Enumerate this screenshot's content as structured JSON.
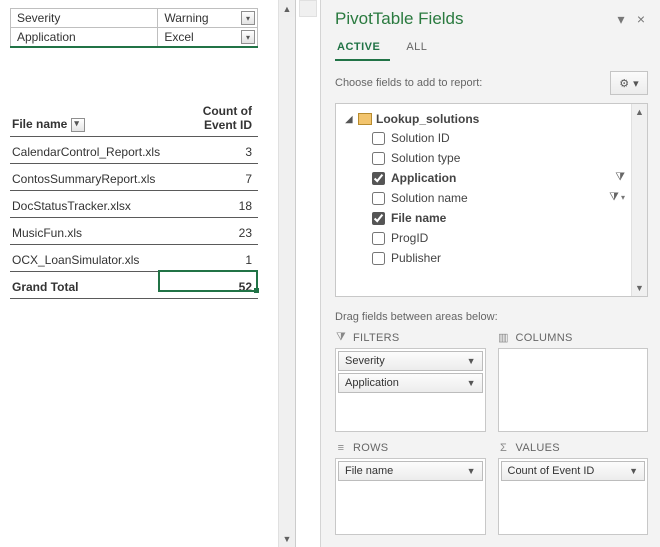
{
  "pivot": {
    "filters": [
      {
        "label": "Severity",
        "value": "Warning"
      },
      {
        "label": "Application",
        "value": "Excel"
      }
    ],
    "row_header": "File name",
    "value_header": "Count of Event ID",
    "rows": [
      {
        "name": "CalendarControl_Report.xls",
        "count": 3
      },
      {
        "name": "ContosSummaryReport.xls",
        "count": 7
      },
      {
        "name": "DocStatusTracker.xlsx",
        "count": 18
      },
      {
        "name": "MusicFun.xls",
        "count": 23
      },
      {
        "name": "OCX_LoanSimulator.xls",
        "count": 1
      }
    ],
    "grand_label": "Grand Total",
    "grand_value": 52
  },
  "panel": {
    "title": "PivotTable Fields",
    "tabs": {
      "active": "ACTIVE",
      "all": "ALL"
    },
    "choose_text": "Choose fields to add to report:",
    "datasource": "Lookup_solutions",
    "fields": [
      {
        "label": "Solution ID",
        "checked": false,
        "bold": false,
        "filter": false
      },
      {
        "label": "Solution type",
        "checked": false,
        "bold": false,
        "filter": false
      },
      {
        "label": "Application",
        "checked": true,
        "bold": true,
        "filter": true
      },
      {
        "label": "Solution name",
        "checked": false,
        "bold": false,
        "filter": true,
        "extra": true
      },
      {
        "label": "File name",
        "checked": true,
        "bold": true,
        "filter": false
      },
      {
        "label": "ProgID",
        "checked": false,
        "bold": false,
        "filter": false
      },
      {
        "label": "Publisher",
        "checked": false,
        "bold": false,
        "filter": false
      }
    ],
    "drag_text": "Drag fields between areas below:",
    "areas": {
      "filters": {
        "title": "FILTERS",
        "items": [
          "Severity",
          "Application"
        ]
      },
      "columns": {
        "title": "COLUMNS",
        "items": []
      },
      "rows": {
        "title": "ROWS",
        "items": [
          "File name"
        ]
      },
      "values": {
        "title": "VALUES",
        "items": [
          "Count of Event ID"
        ]
      }
    }
  }
}
